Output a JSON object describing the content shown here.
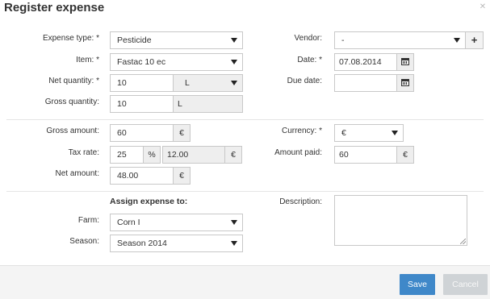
{
  "dialog": {
    "title": "Register expense"
  },
  "labels": {
    "expense_type": "Expense type: *",
    "item": "Item: *",
    "net_quantity": "Net quantity: *",
    "gross_quantity": "Gross quantity:",
    "vendor": "Vendor:",
    "date": "Date: *",
    "due_date": "Due date:",
    "gross_amount": "Gross amount:",
    "tax_rate": "Tax rate:",
    "net_amount": "Net amount:",
    "currency": "Currency: *",
    "amount_paid": "Amount paid:",
    "assign_heading": "Assign expense to:",
    "farm": "Farm:",
    "season": "Season:",
    "description": "Description:"
  },
  "fields": {
    "expense_type": "Pesticide",
    "item": "Fastac 10 ec",
    "net_quantity": "10",
    "net_quantity_unit": "L",
    "gross_quantity": "10",
    "gross_quantity_unit": "L",
    "vendor": "-",
    "vendor_add": "+",
    "date": "07.08.2014",
    "due_date": "",
    "gross_amount": "60",
    "gross_amount_currency": "€",
    "tax_rate": "25",
    "tax_rate_unit": "%",
    "tax_amount": "12.00",
    "tax_amount_currency": "€",
    "net_amount": "48.00",
    "net_amount_currency": "€",
    "currency": "€",
    "amount_paid": "60",
    "amount_paid_currency": "€",
    "farm": "Corn I",
    "season": "Season 2014",
    "description": ""
  },
  "buttons": {
    "save": "Save",
    "cancel": "Cancel"
  },
  "icons": {
    "close": "close-icon",
    "calendar": "calendar-icon",
    "caret": "chevron-down-icon"
  },
  "colors": {
    "primary": "#3f88c9",
    "disabled": "#cfd3d6"
  }
}
